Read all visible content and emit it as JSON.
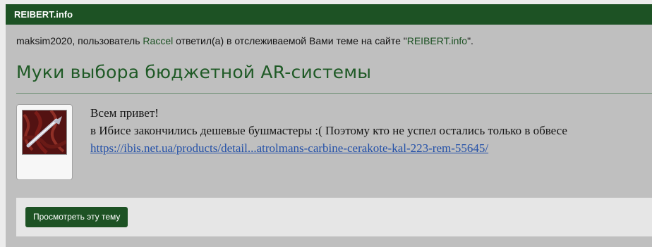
{
  "header": {
    "site_label": "REIBERT.info"
  },
  "notification": {
    "username": "maksim2020",
    "text_before_user": ", пользователь ",
    "replier": "Raccel",
    "text_after_user": " ответил(а) в отслеживаемой Вами теме на сайте \"",
    "site_link": "REIBERT.info",
    "text_end": "\"."
  },
  "thread": {
    "title": "Муки выбора бюджетной AR-системы"
  },
  "post": {
    "avatar_icon": "user-avatar-image",
    "lines": [
      "Всем привет!",
      "в Ибисе закончились дешевые бушмастеры :( Поэтому кто не успел остались только в обвесе"
    ],
    "link": "https://ibis.net.ua/products/detail...atrolmans-carbine-cerakote-kal-223-rem-55645/"
  },
  "actions": {
    "view_thread_label": "Просмотреть эту тему"
  },
  "colors": {
    "brand_green": "#1d5224",
    "title_green": "#1f5a26",
    "link_blue": "#2350a8",
    "content_bg": "#bfbfbf"
  }
}
